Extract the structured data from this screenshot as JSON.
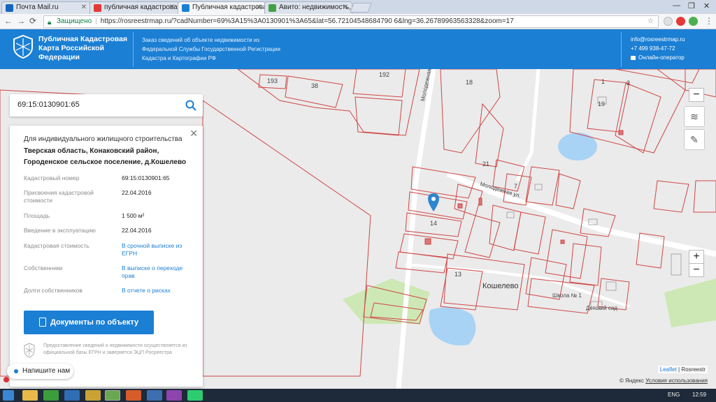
{
  "browser": {
    "tabs": [
      {
        "title": "Почта Mail.ru",
        "icon": "mail-icon",
        "color": "#1565c0"
      },
      {
        "title": "публичная кадастрова",
        "icon": "yandex-icon",
        "color": "#e53935"
      },
      {
        "title": "Публичная кадастровая",
        "icon": "rosreestr-icon",
        "color": "#1b7fd4"
      },
      {
        "title": "Авито: недвижимость,",
        "icon": "avito-icon",
        "color": "#43a047"
      }
    ],
    "secure_label": "Защищено",
    "url": "https://rosreestrmap.ru/?cadNumber=69%3A15%3A0130901%3A65&lat=56.72104548684790 6&lng=36.26789963563328&zoom=17"
  },
  "header": {
    "title": "Публичная Кадастровая Карта Российской Федерации",
    "description": "Заказ сведений об объекте недвижимости из Федеральной Службы Государственной Регистрации Кадастра и Картографии РФ",
    "email": "info@rosreestrmap.ru",
    "phone": "+7 499 938-47-72",
    "online": "Онлайн-оператор",
    "brand_color": "#1b7fd4"
  },
  "search": {
    "value": "69:15:0130901:65"
  },
  "card": {
    "purpose": "Для индивидуального жилищного строительства",
    "address": "Тверская область, Конаковский район, Городенское сельское поселение, д.Кошелево",
    "rows": [
      {
        "key": "Кадастровый номер",
        "value": "69:15:0130901:65",
        "link": false
      },
      {
        "key": "Присвоения кадастровой стоимости",
        "value": "22.04.2016",
        "link": false
      },
      {
        "key": "Площадь",
        "value": "1 500 м²",
        "link": false
      },
      {
        "key": "Введение в эксплуатацию",
        "value": "22.04.2016",
        "link": false
      },
      {
        "key": "Кадастровая стоимость",
        "value": "В срочной выписке из ЕГРН",
        "link": true
      },
      {
        "key": "Собственники",
        "value": "В выписке о переходе прав",
        "link": true
      },
      {
        "key": "Долги собственников",
        "value": "В отчете о рисках",
        "link": true
      }
    ],
    "button": "Документы по объекту",
    "disclaimer": "Предоставление сведений о недвижимости осуществляется из официальной базы ЕГРН и заверяется ЭЦП Росреестра"
  },
  "chat": {
    "label": "Напишите нам"
  },
  "map": {
    "labels": {
      "village": "Кошелево",
      "street1": "Молодежная ул.",
      "street2": "Молодежная ул.",
      "school": "Школа № 1",
      "kindergarten": "Детский сад",
      "p193": "193",
      "p38": "38",
      "p192": "192",
      "p18": "18",
      "p1": "1",
      "p2": "2",
      "p19": "19",
      "p14": "14",
      "p13": "13",
      "p21": "21",
      "p7": "7"
    },
    "zoom_in": "+",
    "zoom_out": "−",
    "attribution_leaflet": "Leaflet",
    "attribution_rest": "| Rosreestr",
    "yandex": "© Яндекс",
    "yandex_terms": "Условия использования"
  },
  "taskbar": {
    "lang": "ENG",
    "time": "12:59"
  }
}
